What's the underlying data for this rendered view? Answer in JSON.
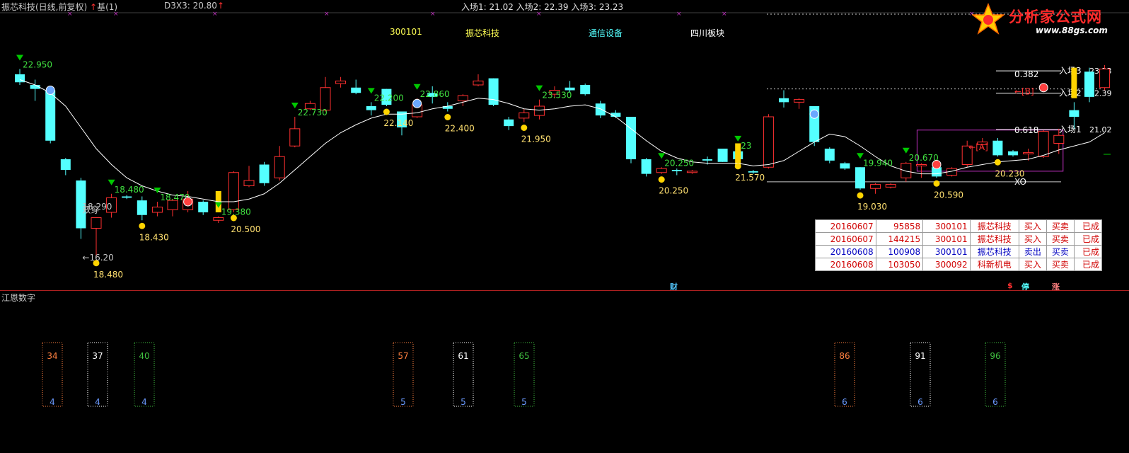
{
  "header": {
    "title": "振芯科技(日线,前复权)",
    "up_arrow": "↑",
    "base_label": "基(1)",
    "d3x3_label": "D3X3: 20.80",
    "d3x3_arrow": "↑",
    "entries_label": "入场1: 21.02  入场2: 22.39  入场3: 23.23"
  },
  "info_row": {
    "code": "300101",
    "name": "振芯科技",
    "industry": "通信设备",
    "region": "四川板块"
  },
  "logo": {
    "title": "分析家公式网",
    "url": "www.88gs.com"
  },
  "colors": {
    "up_candle": "#ff3030",
    "down_candle": "#54ffff",
    "ma_line": "#ffffff",
    "background": "#000000",
    "green_marker": "#00c800",
    "yellow_marker": "#ffd400",
    "purple_box": "#c030c0",
    "red_divider": "#b02020"
  },
  "chart_data": {
    "type": "candlestick",
    "title": "",
    "ylim": [
      15.5,
      24.3
    ],
    "candles": [
      {
        "o": 23.1,
        "h": 23.3,
        "l": 22.7,
        "c": 22.8
      },
      {
        "o": 22.7,
        "h": 22.9,
        "l": 22.1,
        "c": 22.55
      },
      {
        "o": 22.5,
        "h": 22.5,
        "l": 20.5,
        "c": 20.6
      },
      {
        "o": 19.9,
        "h": 19.95,
        "l": 19.3,
        "c": 19.5
      },
      {
        "o": 19.1,
        "h": 19.2,
        "l": 16.9,
        "c": 17.3
      },
      {
        "o": 17.3,
        "h": 17.7,
        "l": 16.2,
        "c": 17.7
      },
      {
        "o": 17.9,
        "h": 18.6,
        "l": 17.7,
        "c": 18.45
      },
      {
        "o": 18.5,
        "h": 18.55,
        "l": 18.4,
        "c": 18.45
      },
      {
        "o": 18.35,
        "h": 18.5,
        "l": 17.6,
        "c": 17.8
      },
      {
        "o": 17.9,
        "h": 18.3,
        "l": 17.75,
        "c": 18.1
      },
      {
        "o": 18.0,
        "h": 18.4,
        "l": 17.75,
        "c": 18.35
      },
      {
        "o": 18.0,
        "h": 18.7,
        "l": 17.9,
        "c": 18.4
      },
      {
        "o": 18.3,
        "h": 18.35,
        "l": 17.8,
        "c": 17.9
      },
      {
        "o": 17.6,
        "h": 17.75,
        "l": 17.5,
        "c": 17.7
      },
      {
        "o": 18.0,
        "h": 19.45,
        "l": 17.9,
        "c": 19.4
      },
      {
        "o": 18.9,
        "h": 19.65,
        "l": 18.85,
        "c": 19.1
      },
      {
        "o": 19.7,
        "h": 19.8,
        "l": 18.9,
        "c": 19.0
      },
      {
        "o": 19.2,
        "h": 20.4,
        "l": 19.1,
        "c": 20.0
      },
      {
        "o": 20.4,
        "h": 21.5,
        "l": 20.35,
        "c": 21.05
      },
      {
        "o": 21.8,
        "h": 22.1,
        "l": 21.75,
        "c": 22.0
      },
      {
        "o": 21.75,
        "h": 23.0,
        "l": 21.7,
        "c": 22.6
      },
      {
        "o": 22.75,
        "h": 23.0,
        "l": 22.6,
        "c": 22.85
      },
      {
        "o": 22.6,
        "h": 22.9,
        "l": 22.35,
        "c": 22.4
      },
      {
        "o": 21.9,
        "h": 22.05,
        "l": 21.55,
        "c": 21.75
      },
      {
        "o": 22.55,
        "h": 22.55,
        "l": 21.9,
        "c": 21.95
      },
      {
        "o": 21.7,
        "h": 21.7,
        "l": 20.8,
        "c": 21.1
      },
      {
        "o": 21.5,
        "h": 22.2,
        "l": 21.45,
        "c": 21.95
      },
      {
        "o": 22.4,
        "h": 22.65,
        "l": 22.0,
        "c": 22.25
      },
      {
        "o": 21.9,
        "h": 22.05,
        "l": 21.7,
        "c": 21.8
      },
      {
        "o": 22.1,
        "h": 22.35,
        "l": 21.9,
        "c": 22.3
      },
      {
        "o": 22.7,
        "h": 23.1,
        "l": 22.65,
        "c": 22.85
      },
      {
        "o": 22.95,
        "h": 22.95,
        "l": 21.9,
        "c": 21.95
      },
      {
        "o": 21.4,
        "h": 21.5,
        "l": 21.0,
        "c": 21.15
      },
      {
        "o": 21.45,
        "h": 21.8,
        "l": 21.3,
        "c": 21.65
      },
      {
        "o": 21.55,
        "h": 22.15,
        "l": 21.4,
        "c": 21.9
      },
      {
        "o": 22.35,
        "h": 22.65,
        "l": 22.2,
        "c": 22.5
      },
      {
        "o": 22.6,
        "h": 22.85,
        "l": 22.4,
        "c": 22.5
      },
      {
        "o": 22.7,
        "h": 22.75,
        "l": 22.3,
        "c": 22.35
      },
      {
        "o": 22.0,
        "h": 22.1,
        "l": 21.45,
        "c": 21.55
      },
      {
        "o": 21.65,
        "h": 21.75,
        "l": 21.45,
        "c": 21.5
      },
      {
        "o": 21.5,
        "h": 21.5,
        "l": 19.75,
        "c": 19.9
      },
      {
        "o": 19.9,
        "h": 19.95,
        "l": 19.25,
        "c": 19.35
      },
      {
        "o": 19.4,
        "h": 19.6,
        "l": 19.35,
        "c": 19.55
      },
      {
        "o": 19.5,
        "h": 19.55,
        "l": 19.3,
        "c": 19.45
      },
      {
        "o": 19.4,
        "h": 19.5,
        "l": 19.35,
        "c": 19.45
      },
      {
        "o": 19.9,
        "h": 20.0,
        "l": 19.7,
        "c": 19.85
      },
      {
        "o": 20.3,
        "h": 20.3,
        "l": 19.8,
        "c": 19.8
      },
      {
        "o": 20.2,
        "h": 20.25,
        "l": 19.85,
        "c": 19.9
      },
      {
        "o": 19.45,
        "h": 19.5,
        "l": 19.35,
        "c": 19.4
      },
      {
        "o": 19.6,
        "h": 21.6,
        "l": 19.55,
        "c": 21.5
      },
      {
        "o": 22.2,
        "h": 22.5,
        "l": 21.85,
        "c": 22.05
      },
      {
        "o": 22.05,
        "h": 22.2,
        "l": 21.8,
        "c": 22.15
      },
      {
        "o": 21.9,
        "h": 21.9,
        "l": 20.4,
        "c": 20.55
      },
      {
        "o": 20.3,
        "h": 20.35,
        "l": 19.75,
        "c": 19.85
      },
      {
        "o": 19.75,
        "h": 19.8,
        "l": 19.5,
        "c": 19.55
      },
      {
        "o": 19.6,
        "h": 19.6,
        "l": 18.75,
        "c": 18.8
      },
      {
        "o": 18.8,
        "h": 19.0,
        "l": 18.6,
        "c": 18.95
      },
      {
        "o": 18.85,
        "h": 19.0,
        "l": 18.8,
        "c": 18.95
      },
      {
        "o": 19.2,
        "h": 19.8,
        "l": 19.05,
        "c": 19.75
      },
      {
        "o": 19.65,
        "h": 19.75,
        "l": 19.2,
        "c": 19.7
      },
      {
        "o": 19.6,
        "h": 19.7,
        "l": 19.2,
        "c": 19.25
      },
      {
        "o": 19.3,
        "h": 19.6,
        "l": 19.25,
        "c": 19.55
      },
      {
        "o": 19.7,
        "h": 20.6,
        "l": 19.6,
        "c": 20.4
      },
      {
        "o": 20.45,
        "h": 20.7,
        "l": 20.35,
        "c": 20.55
      },
      {
        "o": 20.6,
        "h": 20.7,
        "l": 20.0,
        "c": 20.05
      },
      {
        "o": 20.2,
        "h": 20.25,
        "l": 20.0,
        "c": 20.05
      },
      {
        "o": 20.1,
        "h": 20.3,
        "l": 19.85,
        "c": 20.15
      },
      {
        "o": 20.0,
        "h": 21.0,
        "l": 19.95,
        "c": 20.95
      },
      {
        "o": 20.5,
        "h": 21.05,
        "l": 20.1,
        "c": 20.8
      },
      {
        "o": 21.75,
        "h": 22.05,
        "l": 21.05,
        "c": 21.5
      },
      {
        "o": 23.2,
        "h": 23.35,
        "l": 22.05,
        "c": 22.25
      },
      {
        "o": 22.6,
        "h": 23.45,
        "l": 22.5,
        "c": 23.3
      }
    ],
    "ma_line": [
      22.9,
      22.7,
      22.4,
      21.9,
      21.1,
      20.3,
      19.7,
      19.2,
      18.9,
      18.7,
      18.55,
      18.5,
      18.4,
      18.3,
      18.3,
      18.4,
      18.6,
      19.0,
      19.5,
      20.0,
      20.5,
      20.9,
      21.2,
      21.45,
      21.6,
      21.6,
      21.65,
      21.8,
      21.9,
      22.05,
      22.2,
      22.15,
      22.0,
      21.8,
      21.75,
      21.8,
      21.9,
      21.95,
      21.8,
      21.5,
      21.05,
      20.6,
      20.2,
      19.95,
      19.8,
      19.75,
      19.75,
      19.75,
      19.65,
      19.7,
      19.85,
      20.2,
      20.55,
      20.85,
      20.75,
      20.4,
      20.0,
      19.65,
      19.45,
      19.35,
      19.35,
      19.45,
      19.6,
      19.7,
      19.8,
      19.85,
      19.9,
      20.05,
      20.25,
      20.4,
      20.55,
      20.9
    ],
    "low_labels": [
      {
        "i": 5,
        "text": "18.480"
      },
      {
        "i": 8,
        "text": "18.430"
      },
      {
        "i": 14,
        "text": "20.500"
      },
      {
        "i": 24,
        "text": "22.140"
      },
      {
        "i": 28,
        "text": "22.400"
      },
      {
        "i": 33,
        "text": "21.950"
      },
      {
        "i": 42,
        "text": "20.250"
      },
      {
        "i": 47,
        "text": "21.570"
      },
      {
        "i": 55,
        "text": "19.030"
      },
      {
        "i": 60,
        "text": "20.590"
      },
      {
        "i": 64,
        "text": "20.230"
      }
    ],
    "high_labels": [
      {
        "i": 0,
        "text": "22.950"
      },
      {
        "i": 6,
        "text": "18.480"
      },
      {
        "i": 9,
        "text": "18.470"
      },
      {
        "i": 13,
        "text": "19.380"
      },
      {
        "i": 18,
        "text": "22.730"
      },
      {
        "i": 23,
        "text": "22.200"
      },
      {
        "i": 26,
        "text": "22.860"
      },
      {
        "i": 34,
        "text": "23.530"
      },
      {
        "i": 42,
        "text": "20.250"
      },
      {
        "i": 47,
        "text": "23"
      },
      {
        "i": 55,
        "text": "19.940"
      },
      {
        "i": 58,
        "text": "20.670"
      }
    ],
    "extra_text": [
      {
        "x": 4,
        "y": 18.12,
        "text": "18.290"
      },
      {
        "x": 4,
        "y": 18.0,
        "text": "双穿"
      },
      {
        "x": 4,
        "y": 16.2,
        "text": "←16.20"
      },
      {
        "x": 65,
        "y": 23.1,
        "text": "0.382"
      },
      {
        "x": 65,
        "y": 22.45,
        "text": "←[B]"
      },
      {
        "x": 62,
        "y": 20.35,
        "text": "←[A]"
      },
      {
        "x": 65,
        "y": 21.0,
        "text": "0.618"
      },
      {
        "x": 65,
        "y": 19.05,
        "text": "XO"
      }
    ],
    "levels": [
      {
        "label": "入场3",
        "value": "23.23",
        "y": 23.23
      },
      {
        "label": "入场2",
        "value": "22.39",
        "y": 22.39
      },
      {
        "label": "入场1",
        "value": "21.02",
        "y": 21.02
      }
    ]
  },
  "trades": [
    {
      "date": "20160607",
      "id": "95858",
      "code": "300101",
      "name": "振芯科技",
      "side": "买入",
      "op": "买卖",
      "status": "已成",
      "kind": "buy"
    },
    {
      "date": "20160607",
      "id": "144215",
      "code": "300101",
      "name": "振芯科技",
      "side": "买入",
      "op": "买卖",
      "status": "已成",
      "kind": "buy"
    },
    {
      "date": "20160608",
      "id": "100908",
      "code": "300101",
      "name": "振芯科技",
      "side": "卖出",
      "op": "买卖",
      "status": "已成",
      "kind": "sell"
    },
    {
      "date": "20160608",
      "id": "103050",
      "code": "300092",
      "name": "科新机电",
      "side": "买入",
      "op": "买卖",
      "status": "已成",
      "kind": "buy"
    }
  ],
  "markers": {
    "cai": "财",
    "s": "$",
    "ting": "停",
    "zhang": "涨"
  },
  "sub_indicator": {
    "title": "江恩数字",
    "boxes": [
      {
        "top": "34",
        "bottom": "4",
        "style": "dot-red"
      },
      {
        "top": "37",
        "bottom": "4",
        "style": "dot-white"
      },
      {
        "top": "40",
        "bottom": "4",
        "style": "dot-green"
      },
      {
        "top": "57",
        "bottom": "5",
        "style": "dot-red"
      },
      {
        "top": "61",
        "bottom": "5",
        "style": "dot-white"
      },
      {
        "top": "65",
        "bottom": "5",
        "style": "dot-green"
      },
      {
        "top": "86",
        "bottom": "6",
        "style": "dot-red"
      },
      {
        "top": "91",
        "bottom": "6",
        "style": "dot-white"
      },
      {
        "top": "96",
        "bottom": "6",
        "style": "dot-green"
      }
    ]
  }
}
